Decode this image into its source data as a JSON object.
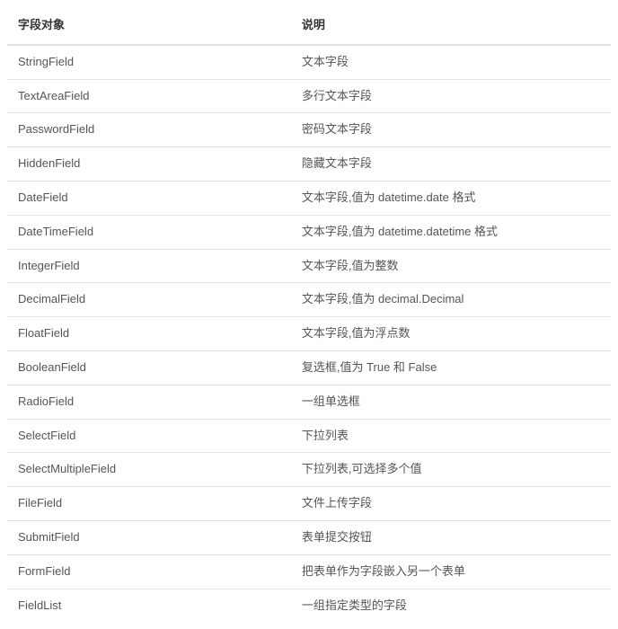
{
  "table": {
    "headers": {
      "field": "字段对象",
      "description": "说明"
    },
    "rows": [
      {
        "field": "StringField",
        "description": "文本字段"
      },
      {
        "field": "TextAreaField",
        "description": "多行文本字段"
      },
      {
        "field": "PasswordField",
        "description": "密码文本字段"
      },
      {
        "field": "HiddenField",
        "description": "隐藏文本字段"
      },
      {
        "field": "DateField",
        "description": "文本字段,值为 datetime.date 格式"
      },
      {
        "field": "DateTimeField",
        "description": "文本字段,值为 datetime.datetime 格式"
      },
      {
        "field": "IntegerField",
        "description": "文本字段,值为整数"
      },
      {
        "field": "DecimalField",
        "description": "文本字段,值为 decimal.Decimal"
      },
      {
        "field": "FloatField",
        "description": "文本字段,值为浮点数"
      },
      {
        "field": "BooleanField",
        "description": "复选框,值为 True 和 False"
      },
      {
        "field": "RadioField",
        "description": "一组单选框"
      },
      {
        "field": "SelectField",
        "description": "下拉列表"
      },
      {
        "field": "SelectMultipleField",
        "description": "下拉列表,可选择多个值"
      },
      {
        "field": "FileField",
        "description": "文件上传字段"
      },
      {
        "field": "SubmitField",
        "description": "表单提交按钮"
      },
      {
        "field": "FormField",
        "description": "把表单作为字段嵌入另一个表单"
      },
      {
        "field": "FieldList",
        "description": "一组指定类型的字段"
      }
    ]
  }
}
